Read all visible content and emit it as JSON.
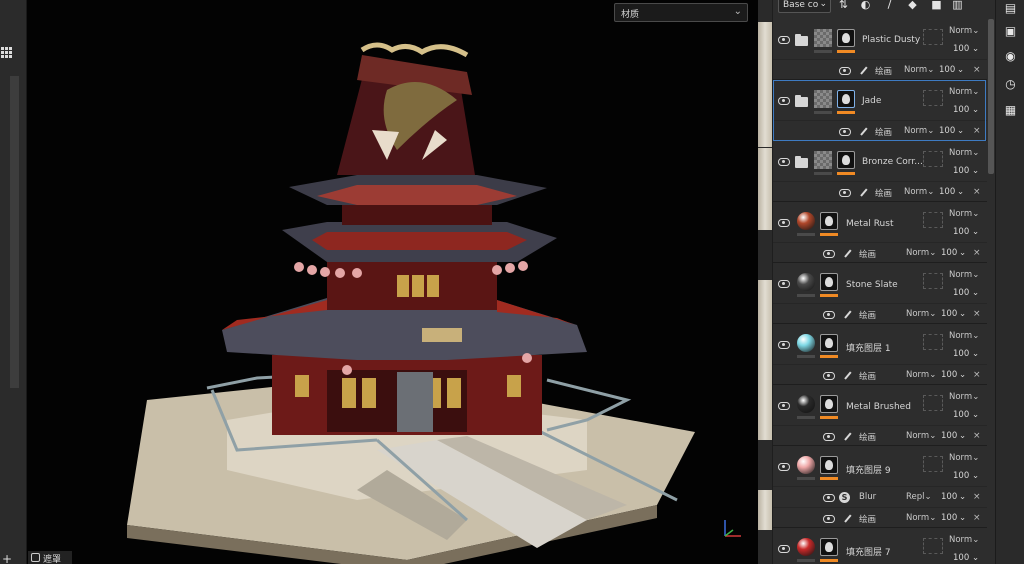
{
  "viewport": {
    "material_dropdown": "材质",
    "view_button": "遮罩"
  },
  "layers_panel": {
    "channel_select": "Base co",
    "top_icons": [
      "filter-icon",
      "mask-icon",
      "paint-brush-icon",
      "fill-bucket-icon",
      "folder-icon",
      "trash-icon"
    ],
    "layers": [
      {
        "name": "Plastic Dusty",
        "type": "folder",
        "blend": "Norm",
        "opacity": "100",
        "sub": [
          {
            "icon": "brush",
            "name": "绘画",
            "blend": "Norm",
            "opacity": "100"
          }
        ]
      },
      {
        "name": "Jade",
        "type": "folder",
        "selected": true,
        "blend": "Norm",
        "opacity": "100",
        "sub": [
          {
            "icon": "brush",
            "name": "绘画",
            "blend": "Norm",
            "opacity": "100"
          }
        ]
      },
      {
        "name": "Bronze Corr...",
        "type": "folder",
        "blend": "Norm",
        "opacity": "100",
        "sub": [
          {
            "icon": "brush",
            "name": "绘画",
            "blend": "Norm",
            "opacity": "100"
          }
        ]
      },
      {
        "name": "Metal Rust",
        "type": "material",
        "color": "#b0472a",
        "blend": "Norm",
        "opacity": "100",
        "sub": [
          {
            "icon": "brush",
            "name": "绘画",
            "blend": "Norm",
            "opacity": "100"
          }
        ]
      },
      {
        "name": "Stone Slate",
        "type": "material",
        "color": "#4a4a4a",
        "blend": "Norm",
        "opacity": "100",
        "sub": [
          {
            "icon": "brush",
            "name": "绘画",
            "blend": "Norm",
            "opacity": "100"
          }
        ]
      },
      {
        "name": "填充图层 1",
        "type": "material",
        "color": "#7fd9e6",
        "blend": "Norm",
        "opacity": "100",
        "sub": [
          {
            "icon": "brush",
            "name": "绘画",
            "blend": "Norm",
            "opacity": "100"
          }
        ]
      },
      {
        "name": "Metal Brushed",
        "type": "material",
        "color": "#2a2a2a",
        "blend": "Norm",
        "opacity": "100",
        "sub": [
          {
            "icon": "brush",
            "name": "绘画",
            "blend": "Norm",
            "opacity": "100"
          }
        ]
      },
      {
        "name": "填充图层 9",
        "type": "material",
        "color": "#f0a8a8",
        "blend": "Norm",
        "opacity": "100",
        "sub": [
          {
            "icon": "s",
            "name": "Blur",
            "blend": "Repl",
            "opacity": "100"
          },
          {
            "icon": "brush",
            "name": "绘画",
            "blend": "Norm",
            "opacity": "100"
          }
        ]
      },
      {
        "name": "填充图层 7",
        "type": "material",
        "color": "#c92a2a",
        "blend": "Norm",
        "opacity": "100",
        "sub": []
      }
    ]
  },
  "right_column_icons": [
    "layers-icon",
    "texture-set-icon",
    "display-settings-icon",
    "history-icon",
    "log-icon"
  ]
}
